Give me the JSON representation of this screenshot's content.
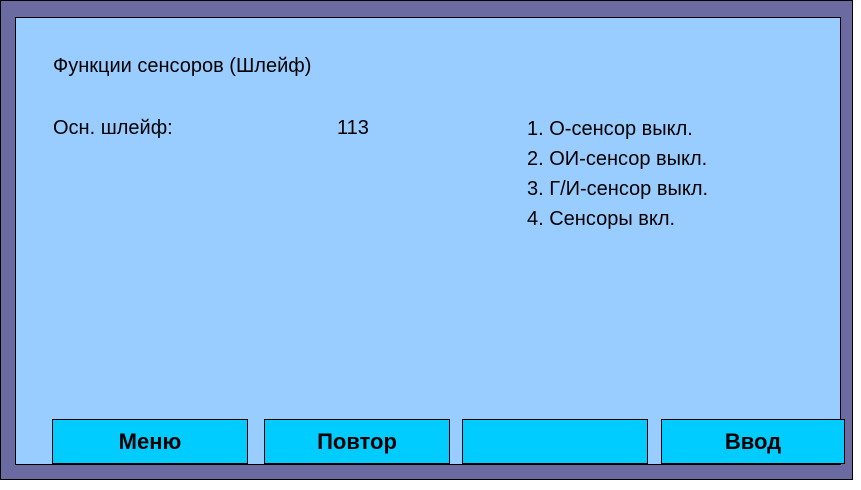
{
  "screen": {
    "title": "Функции сенсоров (Шлейф)",
    "loop_label": "Осн. шлейф:",
    "loop_value": "113",
    "options": [
      "1. О-сенсор выкл.",
      "2. ОИ-сенсор выкл.",
      "3. Г/И-сенсор выкл.",
      "4. Сенсоры вкл."
    ]
  },
  "buttons": {
    "menu": "Меню",
    "repeat": "Повтор",
    "blank": "",
    "enter": "Ввод"
  },
  "colors": {
    "bezel": "#6b6aa1",
    "screen": "#99ccff",
    "button": "#00ccff"
  }
}
